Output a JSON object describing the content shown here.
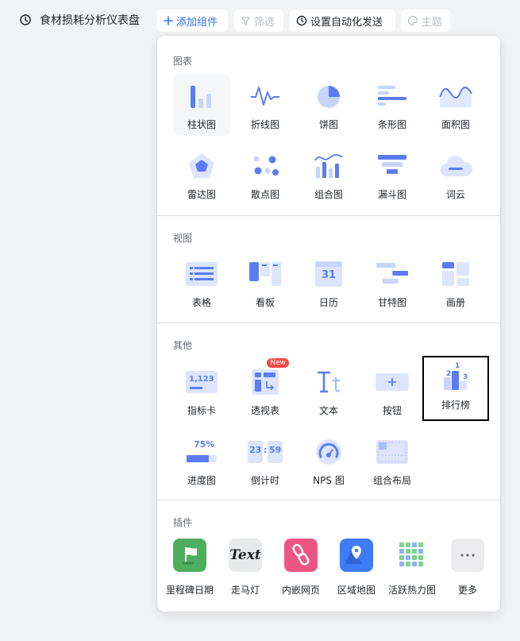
{
  "header": {
    "title": "食材损耗分析仪表盘",
    "add_label": "添加组件",
    "filter_label": "筛选",
    "auto_send_label": "设置自动化发送",
    "theme_label": "主题"
  },
  "sections": {
    "charts": {
      "title": "图表",
      "items": [
        "柱状图",
        "折线图",
        "饼图",
        "条形图",
        "面积图",
        "雷达图",
        "散点图",
        "组合图",
        "漏斗图",
        "词云"
      ]
    },
    "views": {
      "title": "视图",
      "items": [
        "表格",
        "看板",
        "日历",
        "甘特图",
        "画册"
      ],
      "calendar_day": "31"
    },
    "others": {
      "title": "其他",
      "items": [
        "指标卡",
        "透视表",
        "文本",
        "按钮",
        "排行榜",
        "进度图",
        "倒计时",
        "NPS 图",
        "组合布局"
      ],
      "new_badge": "New",
      "metric_value": "1,123",
      "progress_value": "75%",
      "countdown_a": "23",
      "countdown_sep": ":",
      "countdown_b": "59",
      "rank_1": "1",
      "rank_2": "2",
      "rank_3": "3"
    },
    "plugins": {
      "title": "插件",
      "items": [
        "里程碑日期",
        "走马灯",
        "内嵌网页",
        "区域地图",
        "活跃热力图",
        "更多"
      ],
      "marquee_text": "Text"
    }
  },
  "colors": {
    "accent": "#3370ff",
    "icon_primary": "#5b7cf4",
    "icon_light": "#c7d4fb",
    "divider": "#dee0e3",
    "badge": "#f54a45"
  }
}
